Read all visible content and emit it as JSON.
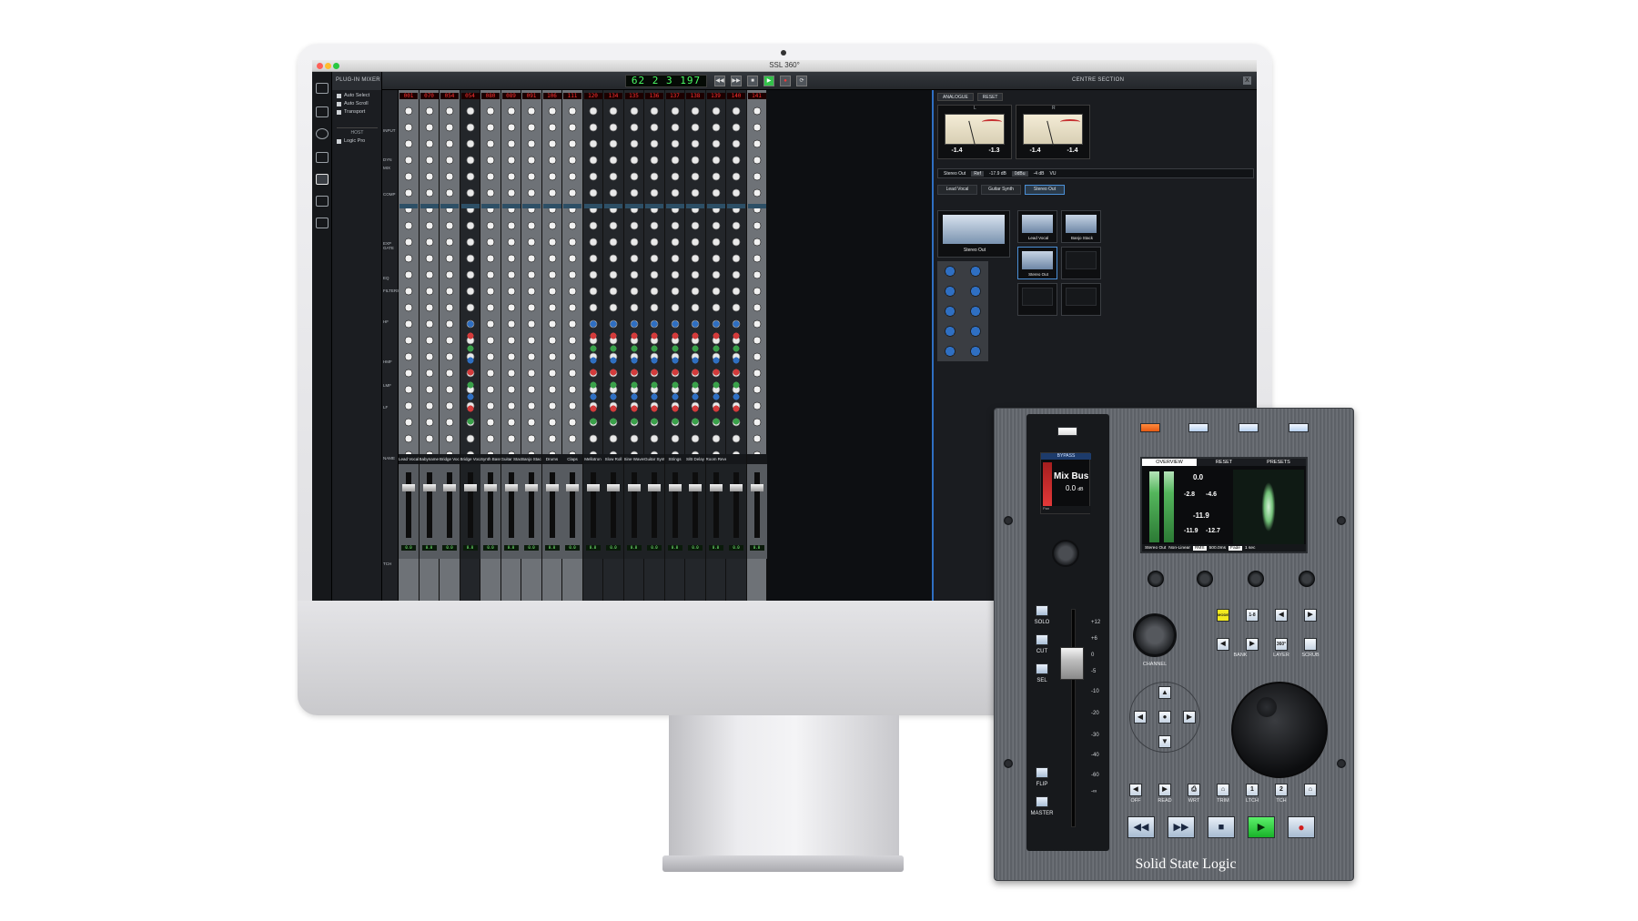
{
  "window": {
    "title": "SSL 360°"
  },
  "left_panel": {
    "header": "PLUG-IN MIXER",
    "options": [
      "Auto Select",
      "Auto Scroll",
      "Transport"
    ],
    "host_label": "HOST",
    "host_value": "Logic Pro"
  },
  "toolbar": {
    "timecode": "62 2 3 197",
    "centre_section_label": "CENTRE SECTION",
    "close_label": "X"
  },
  "row_labels": [
    "INPUT",
    "DYN",
    "MIX",
    "COMP",
    "EXP GATE",
    "EQ",
    "FILTERS",
    "HF",
    "HMF",
    "LMF",
    "LF",
    "NAME",
    "TCH"
  ],
  "strips": {
    "numbers": [
      "001",
      "070",
      "054",
      "080",
      "089",
      "091",
      "106",
      "111",
      "120",
      "134",
      "135",
      "136",
      "137",
      "138",
      "139",
      "140",
      "141"
    ],
    "names": [
      "Lead Vocal",
      "Babyname Vocal",
      "Bridge Vocals",
      "Synth Bass Stack",
      "Guitar Stack",
      "Banjo Stack",
      "Drums",
      "Claps",
      "Mellotron",
      "Slow Roll",
      "Sine Waves",
      "Guitar Synth",
      "Strings",
      "S/B Delay",
      "Room Reverb"
    ],
    "fader_value": "0.0"
  },
  "centre": {
    "tabs": [
      "ANALOGUE",
      "RESET"
    ],
    "vu_left": {
      "label": "L",
      "current": "-1.4",
      "peak": "-1.3"
    },
    "vu_right": {
      "label": "R",
      "current": "-1.4",
      "peak": "-1.4"
    },
    "meter_strip": {
      "source": "Stereo Out",
      "mode": "Ref",
      "ref": "-17.9 dB",
      "unit": "0dBu",
      "gain": "-4 dB",
      "type": "VU"
    },
    "sources": [
      "Lead Vocal",
      "Guitar Synth",
      "Stereo Out"
    ],
    "mini_meters": [
      "Stereo Out",
      "Lead Vocal",
      "Banjo Stack",
      "Stereo Out"
    ]
  },
  "uf1": {
    "brand": "Solid State Logic",
    "channel_screen": {
      "bypass": "BYPASS",
      "name": "Mix Bus",
      "value": "0.0",
      "unit": "dB",
      "pan": "Pan"
    },
    "left_buttons": [
      "SOLO",
      "CUT",
      "SEL",
      "FLIP",
      "MASTER"
    ],
    "fader_scale": [
      "+12",
      "+6",
      "0",
      "-5",
      "-10",
      "-20",
      "-30",
      "-40",
      "-60",
      "-∞"
    ],
    "overview": {
      "tabs": [
        "OVERVIEW",
        "RESET",
        "PRESETS"
      ],
      "peak_l": "0.0",
      "lufs": "-2.8",
      "rms": "-4.6",
      "m_val": "-11.9",
      "s_val": "-11.9",
      "i_val": "-12.7",
      "source": "Stereo Out",
      "mode": "Non-Linear",
      "rms_label": "RMS",
      "window": "500.0ms",
      "fade_label": "Fade",
      "fade_time": "1 sec"
    },
    "bank_keys": [
      "MODE",
      "1-8",
      "◀",
      "▶"
    ],
    "bank_label": "BANK",
    "layer_label": "LAYER",
    "scrub_label": "SCRUB",
    "channel_label": "CHANNEL",
    "layer_key": "360°",
    "automation": [
      "OFF",
      "READ",
      "WRT",
      "TRIM",
      "LTCH",
      "TCH"
    ],
    "automation_keys": [
      "1",
      "2"
    ]
  }
}
